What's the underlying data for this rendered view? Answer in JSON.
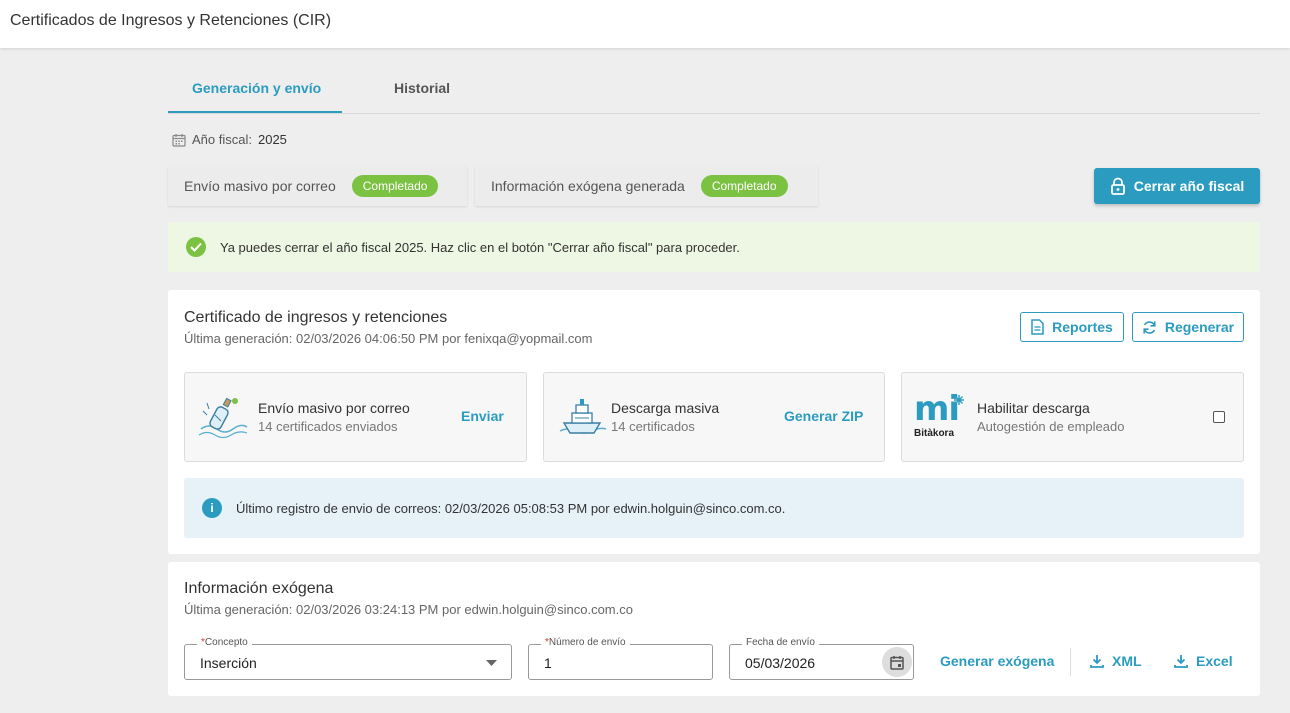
{
  "header": {
    "title": "Certificados de Ingresos y Retenciones (CIR)"
  },
  "tabs": [
    {
      "label": "Generación y envío",
      "active": true
    },
    {
      "label": "Historial",
      "active": false
    }
  ],
  "fiscal": {
    "label": "Año fiscal:",
    "year": "2025"
  },
  "status": [
    {
      "label": "Envío masivo por correo",
      "badge": "Completado"
    },
    {
      "label": "Información exógena generada",
      "badge": "Completado"
    }
  ],
  "close_button": {
    "label": "Cerrar año fiscal",
    "icon": "lock-icon"
  },
  "success_alert": {
    "text": "Ya puedes cerrar el año fiscal 2025. Haz clic en el botón \"Cerrar año fiscal\" para proceder."
  },
  "cir": {
    "title": "Certificado de ingresos y retenciones",
    "subtitle": "Última generación: 02/03/2026 04:06:50 PM por fenixqa@yopmail.com",
    "reportes_label": "Reportes",
    "regenerar_label": "Regenerar",
    "cards": [
      {
        "title": "Envío masivo por correo",
        "subtitle": "14 certificados enviados",
        "action": "Enviar",
        "icon": "mail-bottle-icon"
      },
      {
        "title": "Descarga masiva",
        "subtitle": "14 certificados",
        "action": "Generar ZIP",
        "icon": "ship-icon"
      },
      {
        "title": "Habilitar descarga",
        "subtitle": "Autogestión de empleado",
        "icon": "mi-bitakora-logo",
        "logo_main": "mi",
        "logo_sub": "Bitàkora",
        "checked": false
      }
    ],
    "info": "Último registro de envio de correos: 02/03/2026 05:08:53 PM por edwin.holguin@sinco.com.co."
  },
  "exogena": {
    "title": "Información exógena",
    "subtitle": "Última generación: 02/03/2026 03:24:13 PM por edwin.holguin@sinco.com.co",
    "concepto": {
      "label": "Concepto",
      "value": "Inserción"
    },
    "numero": {
      "label": "Número de envío",
      "value": "1"
    },
    "fecha": {
      "label": "Fecha de envío",
      "value": "05/03/2026"
    },
    "generar_label": "Generar exógena",
    "xml_label": "XML",
    "excel_label": "Excel"
  },
  "colors": {
    "accent": "#2b9cc0",
    "success": "#7cc242",
    "background": "#efeeee"
  }
}
